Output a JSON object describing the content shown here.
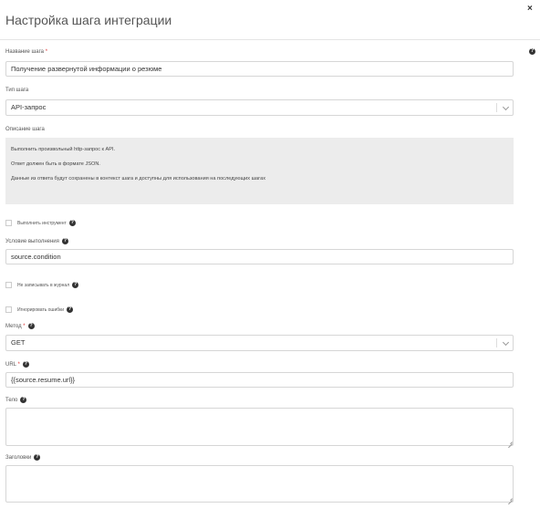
{
  "dialog": {
    "title": "Настройка шага интеграции",
    "close_glyph": "×"
  },
  "fields": {
    "step_name": {
      "label": "Название шага",
      "required_mark": "*",
      "value": "Получение развернутой информации о резюме"
    },
    "step_type": {
      "label": "Тип шага",
      "value": "API-запрос"
    },
    "description": {
      "label": "Описание шага",
      "lines": [
        "Выполнить произвольный http-запрос к API.",
        "Ответ должен быть в формате JSON.",
        "Данные из ответа будут сохранены в контекст шага и доступны для использования на последующих шагах"
      ]
    },
    "run_tool": {
      "label": "Выполнить инструмент",
      "checked": false
    },
    "condition": {
      "label": "Условие выполнения",
      "value": "source.condition"
    },
    "no_log": {
      "label": "Не записывать в журнал",
      "checked": false
    },
    "ignore_errors": {
      "label": "Игнорировать ошибки",
      "checked": false
    },
    "method": {
      "label": "Метод",
      "required_mark": "*",
      "value": "GET"
    },
    "url": {
      "label": "URL",
      "required_mark": "*",
      "value": "{{source.resume.url}}"
    },
    "body": {
      "label": "Тело",
      "value": ""
    },
    "headers": {
      "label": "Заголовки",
      "value": ""
    }
  },
  "help_glyph": "?"
}
